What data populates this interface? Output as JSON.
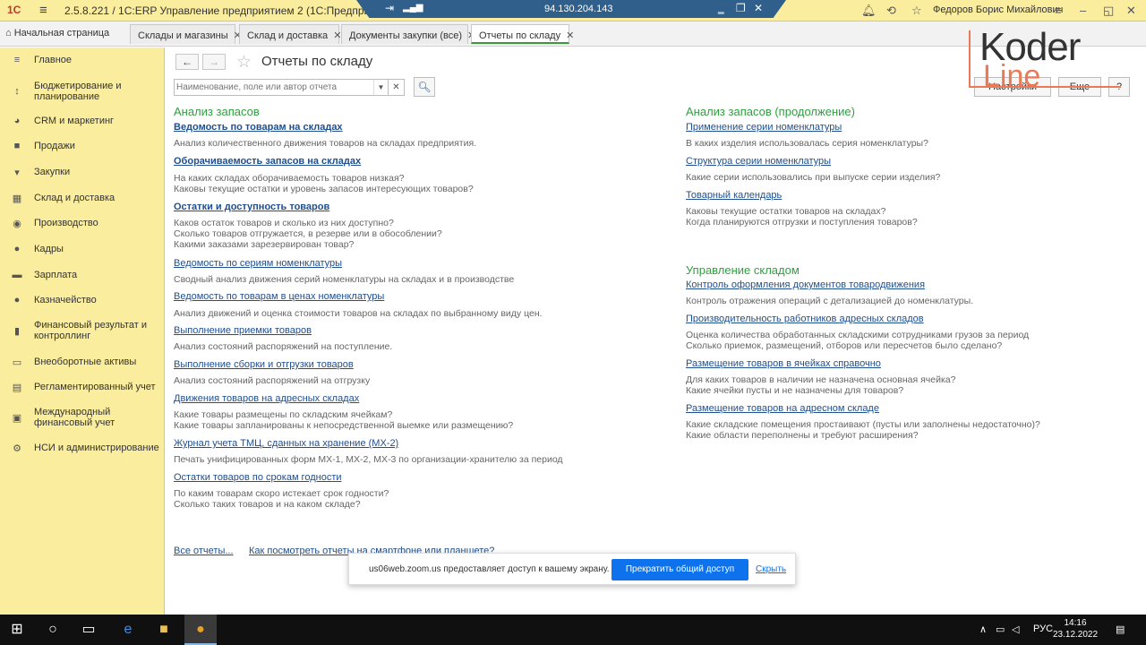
{
  "titlebar": {
    "logo": "1С",
    "title": "2.5.8.221 / 1С:ERP Управление предприятием 2  (1С:Предприятие)",
    "remote_ip": "94.130.204.143",
    "user": "Федоров Борис Михайлович"
  },
  "tabs": {
    "home": "Начальная страница",
    "items": [
      {
        "label": "Склады и магазины"
      },
      {
        "label": "Склад и доставка"
      },
      {
        "label": "Документы закупки (все)"
      },
      {
        "label": "Отчеты по складу"
      }
    ]
  },
  "sidebar": {
    "items": [
      {
        "label": "Главное",
        "icon": "menu-icon"
      },
      {
        "label": "Бюджетирование и планирование",
        "icon": "budget-icon"
      },
      {
        "label": "CRM и маркетинг",
        "icon": "pie-icon"
      },
      {
        "label": "Продажи",
        "icon": "bag-icon"
      },
      {
        "label": "Закупки",
        "icon": "cart-icon"
      },
      {
        "label": "Склад и доставка",
        "icon": "warehouse-icon"
      },
      {
        "label": "Производство",
        "icon": "factory-icon"
      },
      {
        "label": "Кадры",
        "icon": "person-icon"
      },
      {
        "label": "Зарплата",
        "icon": "wallet-icon"
      },
      {
        "label": "Казначейство",
        "icon": "coin-icon"
      },
      {
        "label": "Финансовый результат и контроллинг",
        "icon": "chart-icon"
      },
      {
        "label": "Внеоборотные активы",
        "icon": "truck-icon"
      },
      {
        "label": "Регламентированный учет",
        "icon": "doc-icon"
      },
      {
        "label": "Международный финансовый учет",
        "icon": "globe-icon"
      },
      {
        "label": "НСИ и администрирование",
        "icon": "gear-icon"
      }
    ]
  },
  "main": {
    "title": "Отчеты по складу",
    "search_placeholder": "Наименование, поле или автор отчета",
    "settings_label": "Настройки",
    "more_label": "Еще",
    "help_label": "?",
    "left_section": {
      "title": "Анализ запасов",
      "reports": [
        {
          "link": "Ведомость по товарам на складах",
          "desc": [
            "Анализ количественного движения товаров на складах предприятия."
          ]
        },
        {
          "link": "Оборачиваемость запасов на складах",
          "desc": [
            "На каких складах оборачиваемость товаров низкая?",
            "Каковы текущие остатки и уровень запасов интересующих товаров?"
          ]
        },
        {
          "link": "Остатки и доступность товаров",
          "desc": [
            "Каков остаток товаров и сколько из них доступно?",
            "Сколько товаров отгружается, в резерве или в обособлении?",
            "Какими заказами зарезервирован товар?"
          ]
        },
        {
          "link": "Ведомость по сериям номенклатуры",
          "desc": [
            "Сводный анализ движения серий номенклатуры на складах и в производстве"
          ]
        },
        {
          "link": "Ведомость по товарам в ценах номенклатуры",
          "desc": [
            "Анализ движений и оценка стоимости товаров на складах по выбранному виду цен."
          ]
        },
        {
          "link": "Выполнение приемки товаров",
          "desc": [
            "Анализ состояний распоряжений на поступление."
          ]
        },
        {
          "link": "Выполнение сборки и отгрузки товаров",
          "desc": [
            "Анализ состояний распоряжений на отгрузку"
          ]
        },
        {
          "link": "Движения товаров на адресных складах",
          "desc": [
            "Какие товары размещены по складским ячейкам?",
            "Какие товары запланированы к непосредственной выемке или размещению?"
          ]
        },
        {
          "link": "Журнал учета ТМЦ, сданных на хранение (МХ-2)",
          "desc": [
            "Печать унифицированных форм МХ-1, МХ-2, МХ-3 по организации-хранителю за период"
          ]
        },
        {
          "link": "Остатки товаров по срокам годности",
          "desc": [
            "По каким товарам скоро истекает срок годности?",
            "Сколько таких товаров и на каком складе?"
          ]
        }
      ]
    },
    "right_section": {
      "title": "Анализ запасов (продолжение)",
      "reports": [
        {
          "link": "Применение серии номенклатуры",
          "desc": [
            "В каких изделия использовалась серия номенклатуры?"
          ]
        },
        {
          "link": "Структура серии номенклатуры",
          "desc": [
            "Какие серии использовались при выпуске серии изделия?"
          ]
        },
        {
          "link": "Товарный календарь",
          "desc": [
            "Каковы текущие остатки товаров на складах?",
            "Когда планируются отгрузки и поступления товаров?"
          ]
        }
      ]
    },
    "right_section2": {
      "title": "Управление складом",
      "reports": [
        {
          "link": "Контроль оформления документов товародвижения",
          "desc": [
            "Контроль отражения операций с детализацией до номенклатуры."
          ]
        },
        {
          "link": "Производительность работников адресных складов",
          "desc": [
            "Оценка количества обработанных складскими сотрудниками грузов за период",
            "Сколько приемок, размещений, отборов или пересчетов было сделано?"
          ]
        },
        {
          "link": "Размещение товаров в ячейках справочно",
          "desc": [
            "Для каких товаров в наличии не назначена основная ячейка?",
            "Какие ячейки пусты и не назначены для товаров?"
          ]
        },
        {
          "link": "Размещение товаров на адресном складе",
          "desc": [
            "Какие складские помещения простаивают (пусты или заполнены недостаточно)?",
            "Какие области переполнены и требуют расширения?"
          ]
        }
      ]
    },
    "all_reports": "Все отчеты...",
    "mobile_link": "Как посмотреть отчеты на смартфоне или планшете?"
  },
  "share_popup": {
    "text": "us06web.zoom.us предоставляет доступ к вашему экрану.",
    "stop": "Прекратить общий доступ",
    "hide": "Скрыть"
  },
  "watermark": {
    "koder": "Koder",
    "line": "Line"
  },
  "taskbar": {
    "lang": "РУС",
    "time": "14:16",
    "date": "23.12.2022"
  }
}
